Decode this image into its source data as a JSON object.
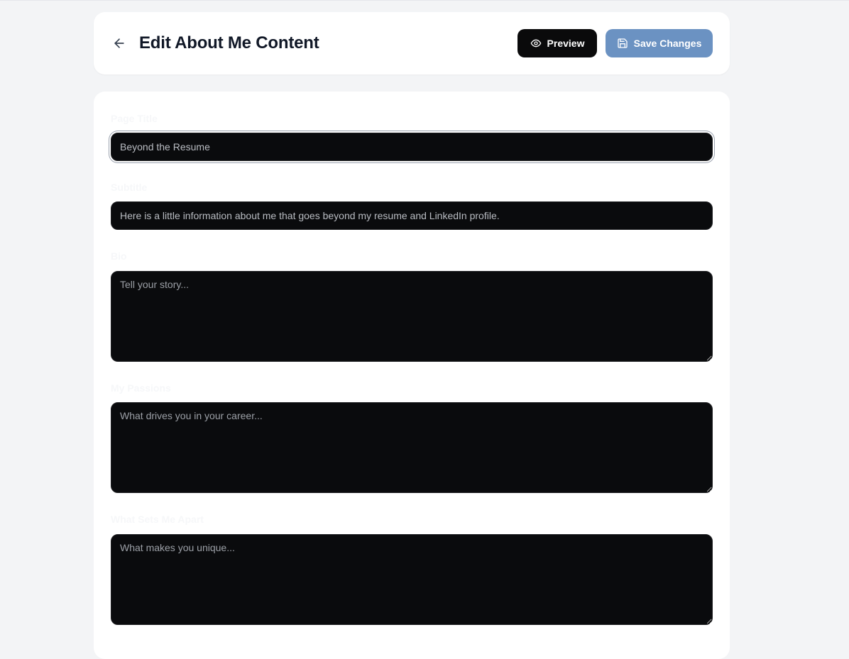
{
  "header": {
    "title": "Edit About Me Content",
    "preview_label": "Preview",
    "save_label": "Save Changes"
  },
  "form": {
    "page_title": {
      "label": "Page Title",
      "value": "Beyond the Resume"
    },
    "subtitle": {
      "label": "Subtitle",
      "value": "Here is a little information about me that goes beyond my resume and LinkedIn profile."
    },
    "bio": {
      "label": "Bio",
      "placeholder": "Tell your story..."
    },
    "passions": {
      "label": "My Passions",
      "placeholder": "What drives you in your career..."
    },
    "sets_apart": {
      "label": "What Sets Me Apart",
      "placeholder": "What makes you unique..."
    }
  },
  "icons": {
    "back": "arrow-left-icon",
    "preview": "eye-icon",
    "save": "save-icon"
  },
  "colors": {
    "background": "#f3f4f6",
    "card": "#ffffff",
    "input_bg": "#0a0b0d",
    "preview_button": "#0a0a0b",
    "save_button": "#6b92c2",
    "title_text": "#111827"
  }
}
